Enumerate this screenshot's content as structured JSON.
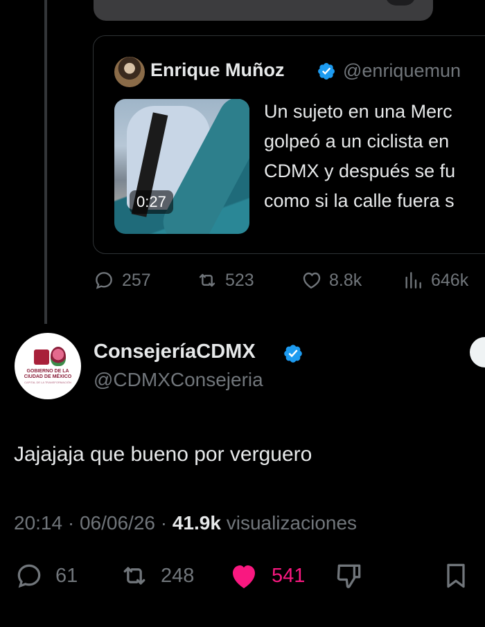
{
  "quoted_tweet": {
    "author_name": "Enrique Muñoz",
    "handle": "@enriquemun",
    "video_duration": "0:27",
    "text": "Un sujeto en una Merc\ngolpeó a un ciclista en\nCDMX y después se fu\ncomo si la calle fuera s",
    "stats": {
      "replies": "257",
      "reposts": "523",
      "likes": "8.8k",
      "views": "646k"
    }
  },
  "main_tweet": {
    "author_name": "ConsejeríaCDMX",
    "handle": "@CDMXConsejeria",
    "avatar_logo": {
      "line1": "GOBIERNO DE LA",
      "line2": "CIUDAD DE MÉXICO",
      "line3": "CAPITAL DE LA TRANSFORMACIÓN"
    },
    "text": "Jajajaja que bueno por verguero",
    "time": "20:14",
    "date": "06/06/26",
    "views_count": "41.9k",
    "views_label": "visualizaciones",
    "actions": {
      "replies": "61",
      "reposts": "248",
      "likes": "541"
    }
  },
  "colors": {
    "background": "#000000",
    "text_primary": "#e7e9ea",
    "text_secondary": "#71767b",
    "like_pink": "#f91880",
    "verified_blue": "#1d9bf0",
    "border": "#2f3336"
  },
  "icons": [
    "reply-icon",
    "repost-icon",
    "like-icon",
    "views-icon",
    "dislike-icon",
    "bookmark-icon",
    "verified-badge-icon"
  ]
}
